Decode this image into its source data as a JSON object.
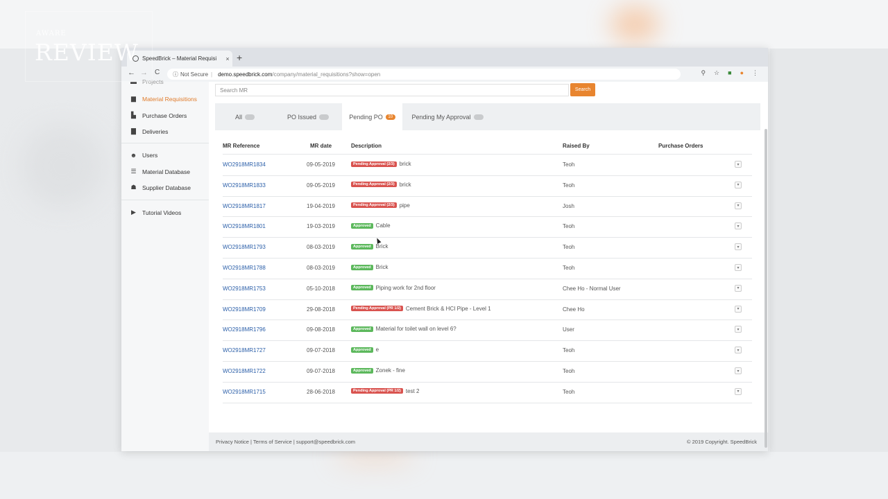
{
  "watermark": {
    "top": "AWARE",
    "main": "REVIEW"
  },
  "browser": {
    "tab_title": "SpeedBrick – Material Requisi",
    "tab_close": "×",
    "new_tab": "+",
    "nav_back": "←",
    "nav_forward": "→",
    "nav_reload": "C",
    "security": "Not Secure",
    "host": "demo.speedbrick.com",
    "path": "/company/material_requisitions?show=open"
  },
  "sidebar": {
    "items": [
      {
        "label": "Projects",
        "icon": "projects-icon"
      },
      {
        "label": "Material Requisitions",
        "icon": "basket-icon"
      },
      {
        "label": "Purchase Orders",
        "icon": "cart-icon"
      },
      {
        "label": "Deliveries",
        "icon": "truck-icon"
      },
      {
        "label": "Users",
        "icon": "users-icon"
      },
      {
        "label": "Material Database",
        "icon": "list-icon"
      },
      {
        "label": "Supplier Database",
        "icon": "supplier-icon"
      },
      {
        "label": "Tutorial Videos",
        "icon": "video-icon"
      }
    ]
  },
  "search": {
    "placeholder": "Search MR",
    "button": "Search"
  },
  "tabs": [
    {
      "label": "All",
      "count": "  "
    },
    {
      "label": "PO Issued",
      "count": "  "
    },
    {
      "label": "Pending PO",
      "count": "10"
    },
    {
      "label": "Pending My Approval",
      "count": "  "
    }
  ],
  "table": {
    "headers": [
      "MR Reference",
      "MR date",
      "Description",
      "Raised By",
      "Purchase Orders"
    ],
    "rows": [
      {
        "ref": "WO2918MR1834",
        "date": "09-05-2019",
        "status": "Pending Approval (2/3)",
        "desc": "brick",
        "raised": "Teoh"
      },
      {
        "ref": "WO2918MR1833",
        "date": "09-05-2019",
        "status": "Pending Approval (2/3)",
        "desc": "brick",
        "raised": "Teoh"
      },
      {
        "ref": "WO2918MR1817",
        "date": "19-04-2019",
        "status": "Pending Approval (2/3)",
        "desc": "pipe",
        "raised": "Josh"
      },
      {
        "ref": "WO2918MR1801",
        "date": "19-03-2019",
        "status": "Approved",
        "desc": "Cable",
        "raised": "Teoh"
      },
      {
        "ref": "WO2918MR1793",
        "date": "08-03-2019",
        "status": "Approved",
        "desc": "Brick",
        "raised": "Teoh"
      },
      {
        "ref": "WO2918MR1788",
        "date": "08-03-2019",
        "status": "Approved",
        "desc": "Brick",
        "raised": "Teoh"
      },
      {
        "ref": "WO2918MR1753",
        "date": "05-10-2018",
        "status": "Approved",
        "desc": "Piping work for 2nd floor",
        "raised": "Chee Ho - Normal User"
      },
      {
        "ref": "WO2918MR1709",
        "date": "29-08-2018",
        "status": "Pending Approval (PR 1/2)",
        "desc": "Cement Brick & HCI Pipe - Level 1",
        "raised": "Chee Ho"
      },
      {
        "ref": "WO2918MR1796",
        "date": "09-08-2018",
        "status": "Approved",
        "desc": "Material for toilet wall on level 6?",
        "raised": "User"
      },
      {
        "ref": "WO2918MR1727",
        "date": "09-07-2018",
        "status": "Approved",
        "desc": "e",
        "raised": "Teoh"
      },
      {
        "ref": "WO2918MR1722",
        "date": "09-07-2018",
        "status": "Approved",
        "desc": "Zonek - fine",
        "raised": "Teoh"
      },
      {
        "ref": "WO2918MR1715",
        "date": "28-06-2018",
        "status": "Pending Approval (PR 1/2)",
        "desc": "test 2",
        "raised": "Teoh"
      }
    ]
  },
  "footer": {
    "left": "Privacy Notice | Terms of Service | support@speedbrick.com",
    "right": "© 2019 Copyright. SpeedBrick"
  },
  "colors": {
    "accent": "#e8852f",
    "link": "#2a5ea8",
    "pending": "#d9534f",
    "approved": "#5cb85c"
  }
}
